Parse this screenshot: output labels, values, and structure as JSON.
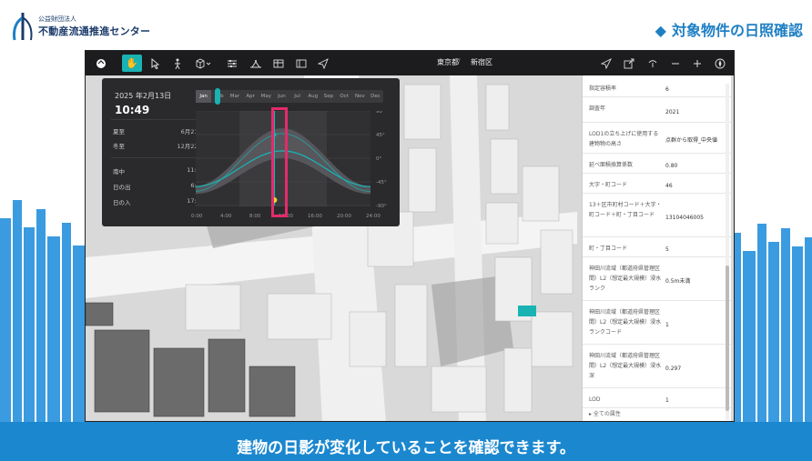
{
  "header": {
    "org_sub": "公益財団法人",
    "org_name": "不動産流通推進センター",
    "title_marker": "◆",
    "title": "対象物件の日照確認"
  },
  "caption": "建物の日影が変化していることを確認できます。",
  "toolbar": {
    "breadcrumb": [
      "東京都",
      "新宿区"
    ],
    "separator": "/",
    "icons_left": [
      "logo-icon",
      "hand-icon",
      "pointer-icon",
      "pedestrian-icon",
      "box-icon",
      "sliders-icon",
      "shadow-icon",
      "table-icon",
      "layers-icon",
      "send-icon"
    ],
    "icons_right": [
      "navigate-icon",
      "export-icon",
      "share-icon",
      "zoom-out-icon",
      "zoom-in-icon",
      "compass-icon"
    ]
  },
  "sun_panel": {
    "date": "2025 年2月13日",
    "time": "10:49",
    "rows": [
      {
        "label": "夏至",
        "value": "6月21日"
      },
      {
        "label": "冬至",
        "value": "12月22日"
      },
      {
        "label": "南中",
        "value": "11:55"
      },
      {
        "label": "日の出",
        "value": "6:30"
      },
      {
        "label": "日の入",
        "value": "17:20"
      }
    ],
    "months": [
      "Jan",
      "Feb",
      "Mar",
      "Apr",
      "May",
      "Jun",
      "Jul",
      "Aug",
      "Sep",
      "Oct",
      "Nov",
      "Dec"
    ],
    "selected_month": "Jan",
    "x_ticks": [
      "0:00",
      "4:00",
      "8:00",
      "12:00",
      "16:00",
      "20:00",
      "24:00"
    ],
    "y_ticks": [
      "90°",
      "45°",
      "0°",
      "-45°",
      "-90°"
    ],
    "current_hour": 10.8,
    "accent": "#19b3b3",
    "highlight": "#e32b6b"
  },
  "attributes": {
    "rows": [
      {
        "key": "指定容積率",
        "value": "6"
      },
      {
        "key": "調査年",
        "value": "2021"
      },
      {
        "key": "LOD1の立ち上げに使用する建物物の高さ",
        "value": "点群から取得_中央値"
      },
      {
        "key": "延べ面積換算係数",
        "value": "0.80"
      },
      {
        "key": "大字・町コード",
        "value": "46"
      },
      {
        "key": "13＋区市町村コード＋大字・町コード＋町・丁目コード",
        "value": "13104046005"
      },
      {
        "key": "町・丁目コード",
        "value": "5"
      },
      {
        "key": "神田川流域（都道府県管理区間）L2（想定最大規模）浸水ランク",
        "value": "0.5m未満"
      },
      {
        "key": "神田川流域（都道府県管理区間）L2（想定最大規模）浸水ランクコード",
        "value": "1"
      },
      {
        "key": "神田川流域（都道府県管理区間）L2（想定最大規模）浸水深",
        "value": "0.297"
      },
      {
        "key": "LOD",
        "value": "1"
      }
    ],
    "footer": "▸ 全ての属性"
  }
}
